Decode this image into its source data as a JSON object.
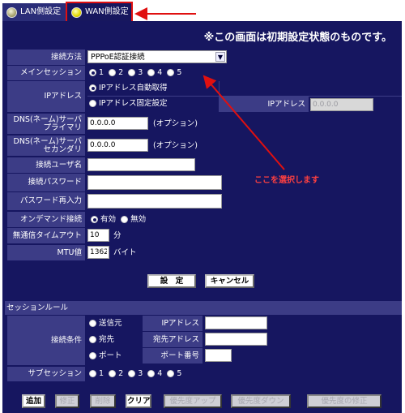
{
  "tabs": {
    "lan": "LAN側設定",
    "wan": "WAN側設定"
  },
  "notice": "※この画面は初期設定状態のものです。",
  "annotation": "ここを選択します",
  "form": {
    "method_label": "接続方法",
    "method_value": "PPPoE認証接続",
    "main_session_label": "メインセッション",
    "sessions": [
      "1",
      "2",
      "3",
      "4",
      "5"
    ],
    "ip_label": "IPアドレス",
    "ip_auto": "IPアドレス自動取得",
    "ip_fixed": "IPアドレス固定設定",
    "ip_fixed_label": "IPアドレス",
    "ip_fixed_value": "0.0.0.0",
    "dns_primary_label_1": "DNS(ネーム)サーバ",
    "dns_primary_label_2": "プライマリ",
    "dns_primary_value": "0.0.0.0",
    "dns_secondary_label_1": "DNS(ネーム)サーバ",
    "dns_secondary_label_2": "セカンダリ",
    "dns_secondary_value": "0.0.0.0",
    "optional": "(オプション)",
    "user_label": "接続ユーザ名",
    "password_label": "接続パスワード",
    "password_confirm_label": "パスワード再入力",
    "on_demand_label": "オンデマンド接続",
    "enabled": "有効",
    "disabled": "無効",
    "timeout_label": "無通信タイムアウト",
    "timeout_value": "10",
    "minutes": "分",
    "mtu_label": "MTU値",
    "mtu_value": "1362",
    "bytes": "バイト",
    "set_button": "設　定",
    "cancel_button": "キャンセル"
  },
  "rules": {
    "title": "セッションルール",
    "condition_label": "接続条件",
    "source": "送信元",
    "destination": "宛先",
    "port": "ポート",
    "ip_label": "IPアドレス",
    "dest_ip_label": "宛先アドレス",
    "port_label": "ポート番号",
    "subsession_label": "サブセッション",
    "subsessions": [
      "1",
      "2",
      "3",
      "4",
      "5"
    ]
  },
  "buttons": {
    "add": "追加",
    "edit": "修正",
    "delete": "削除",
    "clear": "クリア",
    "priority_up": "優先度アップ",
    "priority_down": "優先度ダウン",
    "priority_edit": "優先度の修正"
  },
  "colors": {
    "panel": "#161660",
    "label_cell": "#3c3c86",
    "accent_red": "#e01010"
  }
}
